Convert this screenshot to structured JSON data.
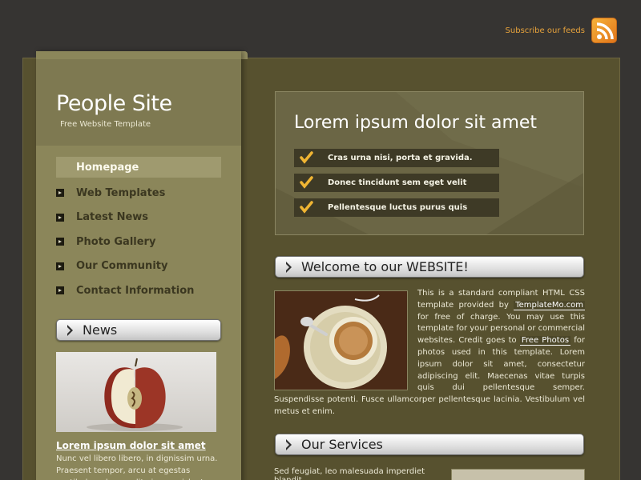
{
  "header": {
    "feed_label": "Subscribe our feeds"
  },
  "site": {
    "title": "People Site",
    "subtitle": "Free Website Template"
  },
  "menu": [
    {
      "label": "Homepage",
      "active": true
    },
    {
      "label": "Web Templates"
    },
    {
      "label": "Latest News"
    },
    {
      "label": "Photo Gallery"
    },
    {
      "label": "Our Community"
    },
    {
      "label": "Contact Information"
    }
  ],
  "news": {
    "heading": "News",
    "title": "Lorem ipsum dolor sit amet",
    "text": "Nunc vel libero libero, in dignissim urna. Praesent tempor, arcu at egestas vestibulum, lorem elit viverra nisl, at consequat neque lacus"
  },
  "banner": {
    "title": "Lorem ipsum dolor sit amet",
    "items": [
      "Cras urna nisi, porta et gravida.",
      "Donec tincidunt sem eget velit",
      "Pellentesque luctus purus quis"
    ]
  },
  "welcome": {
    "heading": "Welcome to our WEBSITE!",
    "text_1": "This is a standard compliant HTML CSS template provided by ",
    "link_1": "TemplateMo.com",
    "text_2": " for free of charge. You may use this template for your personal or commercial websites. Credit goes to ",
    "link_2": "Free Photos",
    "text_3": " for photos used in this template. Lorem ipsum dolor sit amet, consectetur adipiscing elit. Maecenas vitae turpis quis dui pellentesque semper. Suspendisse potenti. Fusce ullamcorper pellentesque lacinia. Vestibulum vel metus et enim."
  },
  "services": {
    "heading": "Our Services",
    "text": "Sed feugiat, leo malesuada imperdiet blandit,"
  },
  "colors": {
    "accent": "#e8a33c",
    "sidebar": "#8b865a",
    "content": "#57512f"
  }
}
